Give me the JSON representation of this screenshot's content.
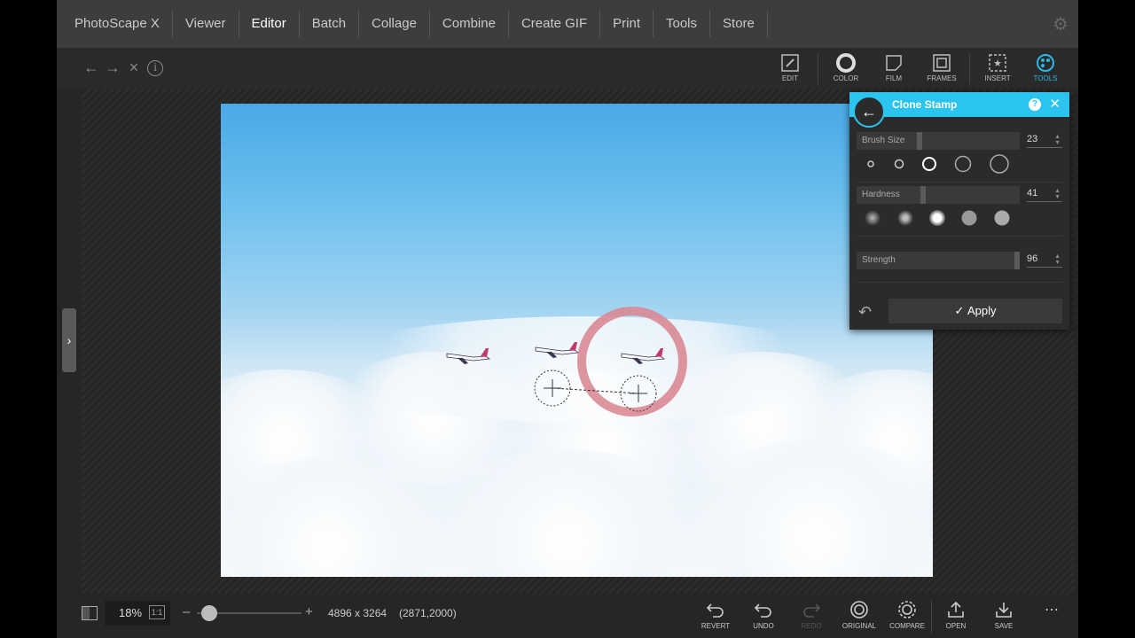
{
  "nav": {
    "items": [
      "PhotoScape X",
      "Viewer",
      "Editor",
      "Batch",
      "Collage",
      "Combine",
      "Create GIF",
      "Print",
      "Tools",
      "Store"
    ],
    "active": "Editor"
  },
  "toolbar": {
    "back_icon": "arrow-left-icon",
    "forward_icon": "arrow-right-icon",
    "close_icon": "close-icon",
    "info_icon": "info-icon",
    "tabs": [
      {
        "label": "EDIT",
        "icon": "edit-icon"
      },
      {
        "label": "COLOR",
        "icon": "color-icon"
      },
      {
        "label": "FILM",
        "icon": "film-icon"
      },
      {
        "label": "FRAMES",
        "icon": "frames-icon"
      },
      {
        "label": "INSERT",
        "icon": "insert-icon"
      },
      {
        "label": "TOOLS",
        "icon": "tools-icon"
      }
    ],
    "active_tab": "TOOLS"
  },
  "panel": {
    "title": "Clone Stamp",
    "brush_size": {
      "label": "Brush Size",
      "value": "23",
      "fraction": 0.23
    },
    "hardness": {
      "label": "Hardness",
      "value": "41",
      "fraction": 0.41
    },
    "strength": {
      "label": "Strength",
      "value": "96",
      "fraction": 0.96
    },
    "apply_label": "Apply"
  },
  "bottom": {
    "zoom": "18%",
    "one_to_one": "1:1",
    "zoom_slider_fraction": 0.12,
    "dimensions": "4896 x 3264",
    "coords": "(2871,2000)",
    "actions": [
      {
        "label": "REVERT",
        "icon": "revert-icon"
      },
      {
        "label": "UNDO",
        "icon": "undo-icon"
      },
      {
        "label": "REDO",
        "icon": "redo-icon"
      },
      {
        "label": "ORIGINAL",
        "icon": "original-icon"
      },
      {
        "label": "COMPARE",
        "icon": "compare-icon"
      },
      {
        "label": "OPEN",
        "icon": "open-icon"
      },
      {
        "label": "SAVE",
        "icon": "save-icon"
      }
    ],
    "more_icon": "more-icon"
  },
  "colors": {
    "accent": "#2bc4ee",
    "brush_ring": "#d98a94"
  }
}
